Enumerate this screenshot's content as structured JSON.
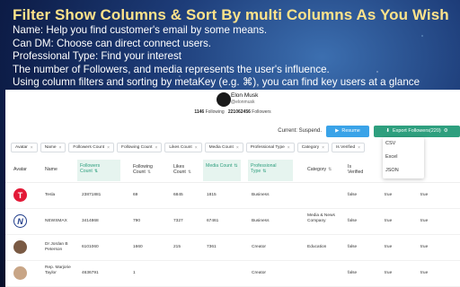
{
  "hero": {
    "title": "Filter Show Columns & Sort By multi Columns As You Wish",
    "lines": [
      "Name: Help you find customer's email by some means.",
      "Can DM: Choose can direct connect users.",
      "Professional Type: Find your interest",
      "The number of Followers, and media represents the user's influence.",
      "Using column filters and sorting by metaKey (e.g. ⌘), you can find key users at a glance"
    ]
  },
  "profile": {
    "name": "Elon Musk",
    "handle": "@elonmusk",
    "following_count": "1146",
    "following_label": "Following",
    "followers_count": "221062456",
    "followers_label": "Followers"
  },
  "toolbar": {
    "status": "Current: Suspend.",
    "resume_label": "Resume",
    "export_label": "Export Followers(220)"
  },
  "export_menu": [
    "CSV",
    "Excel",
    "JSON"
  ],
  "filters": [
    "Avatar",
    "Name",
    "Followers Count",
    "Following Count",
    "Likes Count",
    "Media Count",
    "Professional Type",
    "Category",
    "Is Verified"
  ],
  "headers": {
    "avatar": "Avatar",
    "name": "Name",
    "followers": "Followers Count",
    "following": "Following Count",
    "likes": "Likes Count",
    "media": "Media Count",
    "prof_type": "Professional Type",
    "category": "Category",
    "verified": "Is Verified"
  },
  "rows": [
    {
      "avatar": "T",
      "name": "Tesla",
      "followers": "23871881",
      "following": "69",
      "likes": "6845",
      "media": "1815",
      "prof_type": "Business",
      "category": "",
      "verified": "false",
      "c1": "true",
      "c2": "true"
    },
    {
      "avatar": "N",
      "name": "NEWSMAX",
      "followers": "3414868",
      "following": "790",
      "likes": "7327",
      "media": "67461",
      "prof_type": "Business",
      "category": "Media & News Company",
      "verified": "false",
      "c1": "true",
      "c2": "true"
    },
    {
      "avatar": "",
      "name": "Dr Jordan B Peterson",
      "followers": "6101060",
      "following": "1660",
      "likes": "215",
      "media": "7361",
      "prof_type": "Creator",
      "category": "Education",
      "verified": "false",
      "c1": "true",
      "c2": "true"
    },
    {
      "avatar": "",
      "name": "Rep. Marjorie Taylor",
      "followers": "4636791",
      "following": "1",
      "likes": "",
      "media": "",
      "prof_type": "Creator",
      "category": "",
      "verified": "false",
      "c1": "true",
      "c2": "true"
    }
  ],
  "colors": {
    "accent_green": "#2e9f7e",
    "accent_blue": "#3aa3e8",
    "title_yellow": "#ffe38a"
  }
}
